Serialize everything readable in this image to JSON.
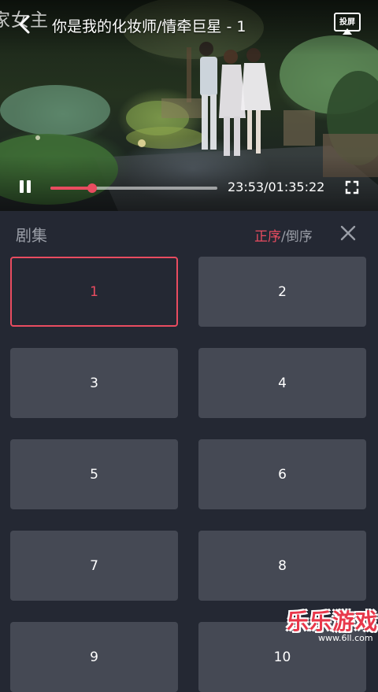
{
  "player": {
    "corner_watermark": "家女主",
    "title": "你是我的化妆师/情牵巨星 - 1",
    "cast_label": "投屏",
    "time_readout": "23:53/01:35:22",
    "progress_fraction": 0.25,
    "accent_color": "#e94c60"
  },
  "panel": {
    "title": "剧集",
    "sort_asc": "正序",
    "sort_sep": "/",
    "sort_desc": "倒序",
    "selected_episode": "1",
    "episodes": [
      "1",
      "2",
      "3",
      "4",
      "5",
      "6",
      "7",
      "8",
      "9",
      "10"
    ]
  },
  "site_watermark": {
    "brand": "乐乐游戏",
    "url": "www.6ll.com"
  },
  "icons": [
    "back-arrow-icon",
    "cast-icon",
    "pause-icon",
    "fullscreen-icon",
    "close-icon"
  ]
}
